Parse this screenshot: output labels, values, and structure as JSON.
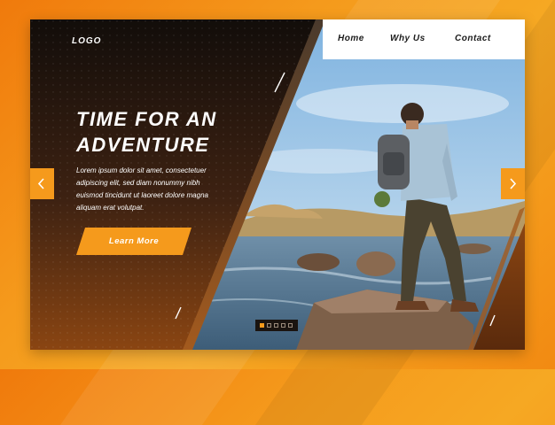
{
  "brand": {
    "logo": "LOGO"
  },
  "nav": {
    "items": [
      "Home",
      "Why Us",
      "Contact"
    ]
  },
  "hero": {
    "title_line1": "TIME FOR AN",
    "title_line2": "ADVENTURE",
    "body": "Lorem ipsum dolor sit amet, consectetuer adipiscing elit, sed diam nonummy nibh euismod tincidunt ut laoreet dolore magna aliquam erat volutpat.",
    "cta_label": "Learn More"
  },
  "carousel": {
    "slides": 5,
    "active_index": 0
  },
  "colors": {
    "accent": "#f59a1c",
    "dark": "#1a1410",
    "panel_bottom": "#7a3a12"
  },
  "icons": {
    "prev": "chevron-left-icon",
    "next": "chevron-right-icon"
  }
}
